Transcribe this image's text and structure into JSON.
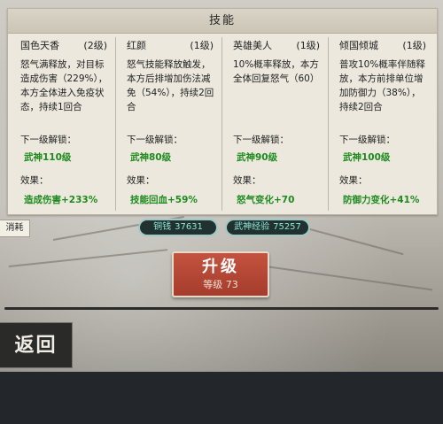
{
  "panel": {
    "title": "技能"
  },
  "skills": [
    {
      "name": "国色天香",
      "level": "(2级)",
      "desc": "怒气满释放，对目标造成伤害（229%），本方全体进入免疫状态，持续1回合",
      "unlock_label": "下一级解锁：",
      "unlock_value": "武神110级",
      "effect_label": "效果：",
      "effect_value": "造成伤害+233%"
    },
    {
      "name": "红颜",
      "level": "(1级)",
      "desc": "怒气技能释放触发，本方后排增加伤法减免（54%），持续2回合",
      "unlock_label": "下一级解锁：",
      "unlock_value": "武神80级",
      "effect_label": "效果：",
      "effect_value": "技能回血+59%"
    },
    {
      "name": "英雄美人",
      "level": "(1级)",
      "desc": "10%概率释放，本方全体回复怒气（60）",
      "unlock_label": "下一级解锁：",
      "unlock_value": "武神90级",
      "effect_label": "效果：",
      "effect_value": "怒气变化+70"
    },
    {
      "name": "倾国倾城",
      "level": "(1级)",
      "desc": "普攻10%概率伴随释放，本方前排单位增加防御力（38%），持续2回合",
      "unlock_label": "下一级解锁：",
      "unlock_value": "武神100级",
      "effect_label": "效果：",
      "effect_value": "防御力变化+41%"
    }
  ],
  "cost": {
    "tag": "消耗",
    "copper_label": "铜钱",
    "copper_value": "37631",
    "exp_label": "武神经验",
    "exp_value": "75257"
  },
  "upgrade": {
    "label": "升级",
    "level": "等级 73"
  },
  "back": {
    "label": "返回"
  },
  "colors": {
    "accent_green": "#1e8a1e",
    "button_red": "#b24634",
    "cost_text": "#8fe6d7"
  }
}
